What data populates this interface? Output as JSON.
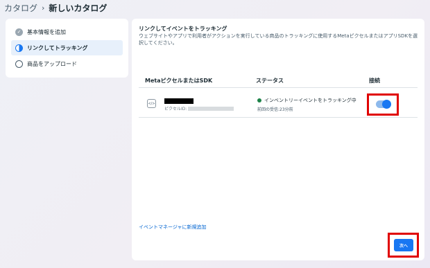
{
  "breadcrumb": {
    "root": "カタログ",
    "separator": "›",
    "current": "新しいカタログ"
  },
  "steps": [
    {
      "label": "基本情報を追加",
      "state": "done",
      "icon": "check-circle-icon"
    },
    {
      "label": "リンクしてトラッキング",
      "state": "active",
      "icon": "half-circle-icon"
    },
    {
      "label": "商品をアップロード",
      "state": "pending",
      "icon": "empty-circle-icon"
    }
  ],
  "panel": {
    "title": "リンクしてイベントをトラッキング",
    "description": "ウェブサイトやアプリで利用者がアクションを実行している商品のトラッキングに使用するMetaピクセルまたはアプリSDKを選択してください。",
    "columns": {
      "source": "MetaピクセルまたはSDK",
      "status": "ステータス",
      "connect": "接続"
    },
    "rows": [
      {
        "icon": "code-icon",
        "icon_glyph": "</>",
        "name": "",
        "id_label": "ピクセルID:",
        "id_value": "",
        "status": "インベントリーイベントをトラッキング中",
        "status_color": "#1d8348",
        "last_received": "前回の受信:23分前",
        "connected": true
      }
    ],
    "event_link": "イベントマネージャに新規追加",
    "next_button": "次へ"
  },
  "colors": {
    "accent": "#1877f2",
    "highlight": "#e00000"
  }
}
